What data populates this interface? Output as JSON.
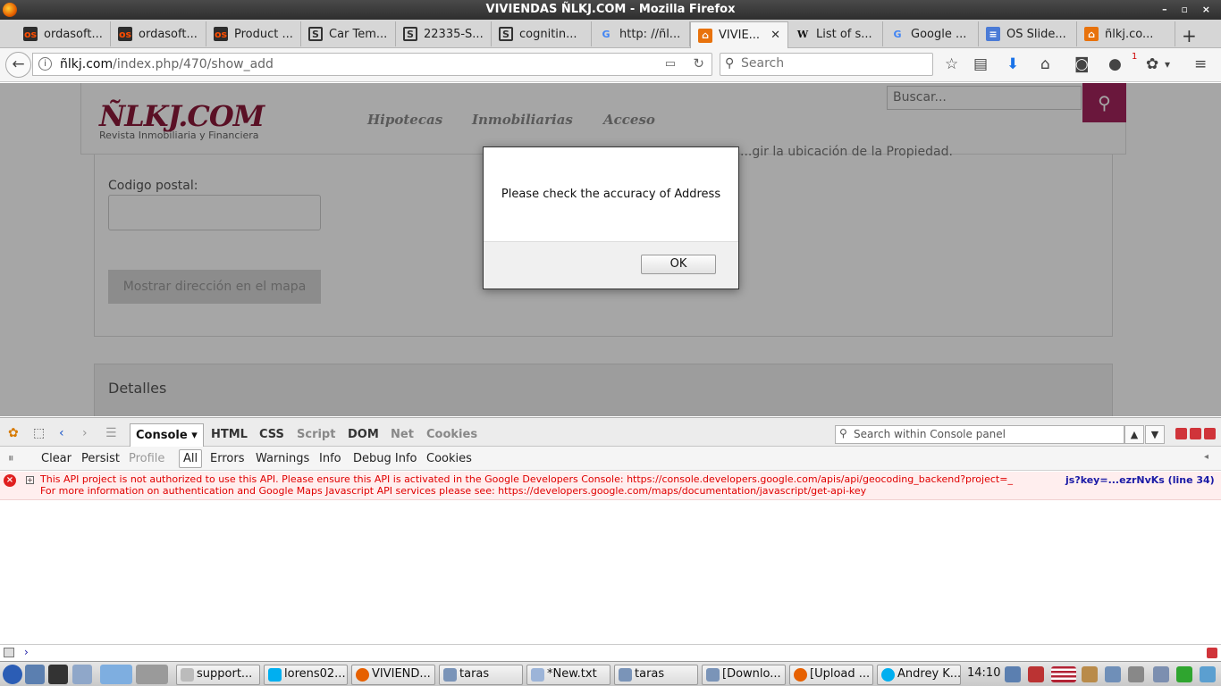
{
  "window": {
    "title": "VIVIENDAS ÑLKJ.COM - Mozilla Firefox",
    "controls": "–  ▫  ×"
  },
  "tabs": [
    {
      "label": "ordasoft...",
      "icon": "ordasoft-icon"
    },
    {
      "label": "ordasoft...",
      "icon": "ordasoft-icon"
    },
    {
      "label": "Product ...",
      "icon": "ordasoft-icon"
    },
    {
      "label": "Car Tem...",
      "icon": "stackexchange-icon"
    },
    {
      "label": "22335-S...",
      "icon": "stackexchange-icon"
    },
    {
      "label": "cognitin...",
      "icon": "stackexchange-icon"
    },
    {
      "label": "http: //ñl...",
      "icon": "google-icon"
    },
    {
      "label": "VIVIE...",
      "icon": "house-icon",
      "active": true
    },
    {
      "label": "List of s...",
      "icon": "wikipedia-icon"
    },
    {
      "label": "Google ...",
      "icon": "google-translate-icon"
    },
    {
      "label": "OS Slide...",
      "icon": "docs-icon"
    },
    {
      "label": "ñlkj.co...",
      "icon": "house-icon"
    }
  ],
  "navbar": {
    "url_domain": "ñlkj.com",
    "url_path": "/index.php/470/show_add",
    "search_placeholder": "Search",
    "notification_badge": "1"
  },
  "site": {
    "logo": "ÑLKJ.COM",
    "logo_subtitle": "Revista Inmobiliaria y Financiera",
    "nav": [
      "Hipotecas",
      "Inmobiliarias",
      "Acceso"
    ],
    "search_placeholder": "Buscar...",
    "postal_code_label": "Codigo postal:",
    "map_button": "Mostrar dirección en el mapa",
    "location_hint": "...gir la ubicación de la Propiedad.",
    "details_heading": "Detalles"
  },
  "dialog": {
    "message": "Please check the accuracy of Address",
    "ok_label": "OK"
  },
  "firebug": {
    "tabs": [
      "Console",
      "HTML",
      "CSS",
      "Script",
      "DOM",
      "Net",
      "Cookies"
    ],
    "active_tab": "Console",
    "search_placeholder": "Search within Console panel",
    "filters": [
      "Clear",
      "Persist",
      "Profile",
      "All",
      "Errors",
      "Warnings",
      "Info",
      "Debug Info",
      "Cookies"
    ],
    "active_filter": "All",
    "error": {
      "line1": "This API project is not authorized to use this API. Please ensure this API is activated in the Google Developers Console: https://console.developers.google.com/apis/api/geocoding_backend?project=_",
      "line2": "For more information on authentication and Google Maps Javascript API services please see: https://developers.google.com/maps/documentation/javascript/get-api-key",
      "source": "js?key=...ezrNvKs (line 34)"
    },
    "prompt": "›"
  },
  "taskbar": {
    "items": [
      "support...",
      "lorens02...",
      "VIVIEND...",
      "taras",
      "*New.txt",
      "taras",
      "[Downlo...",
      "[Upload ...",
      "Andrey K..."
    ],
    "clock": "14:10"
  },
  "colors": {
    "brand": "#8b1a3a",
    "search_button": "#a4245c",
    "error_text": "#e00000",
    "error_bg": "#ffeeee"
  }
}
